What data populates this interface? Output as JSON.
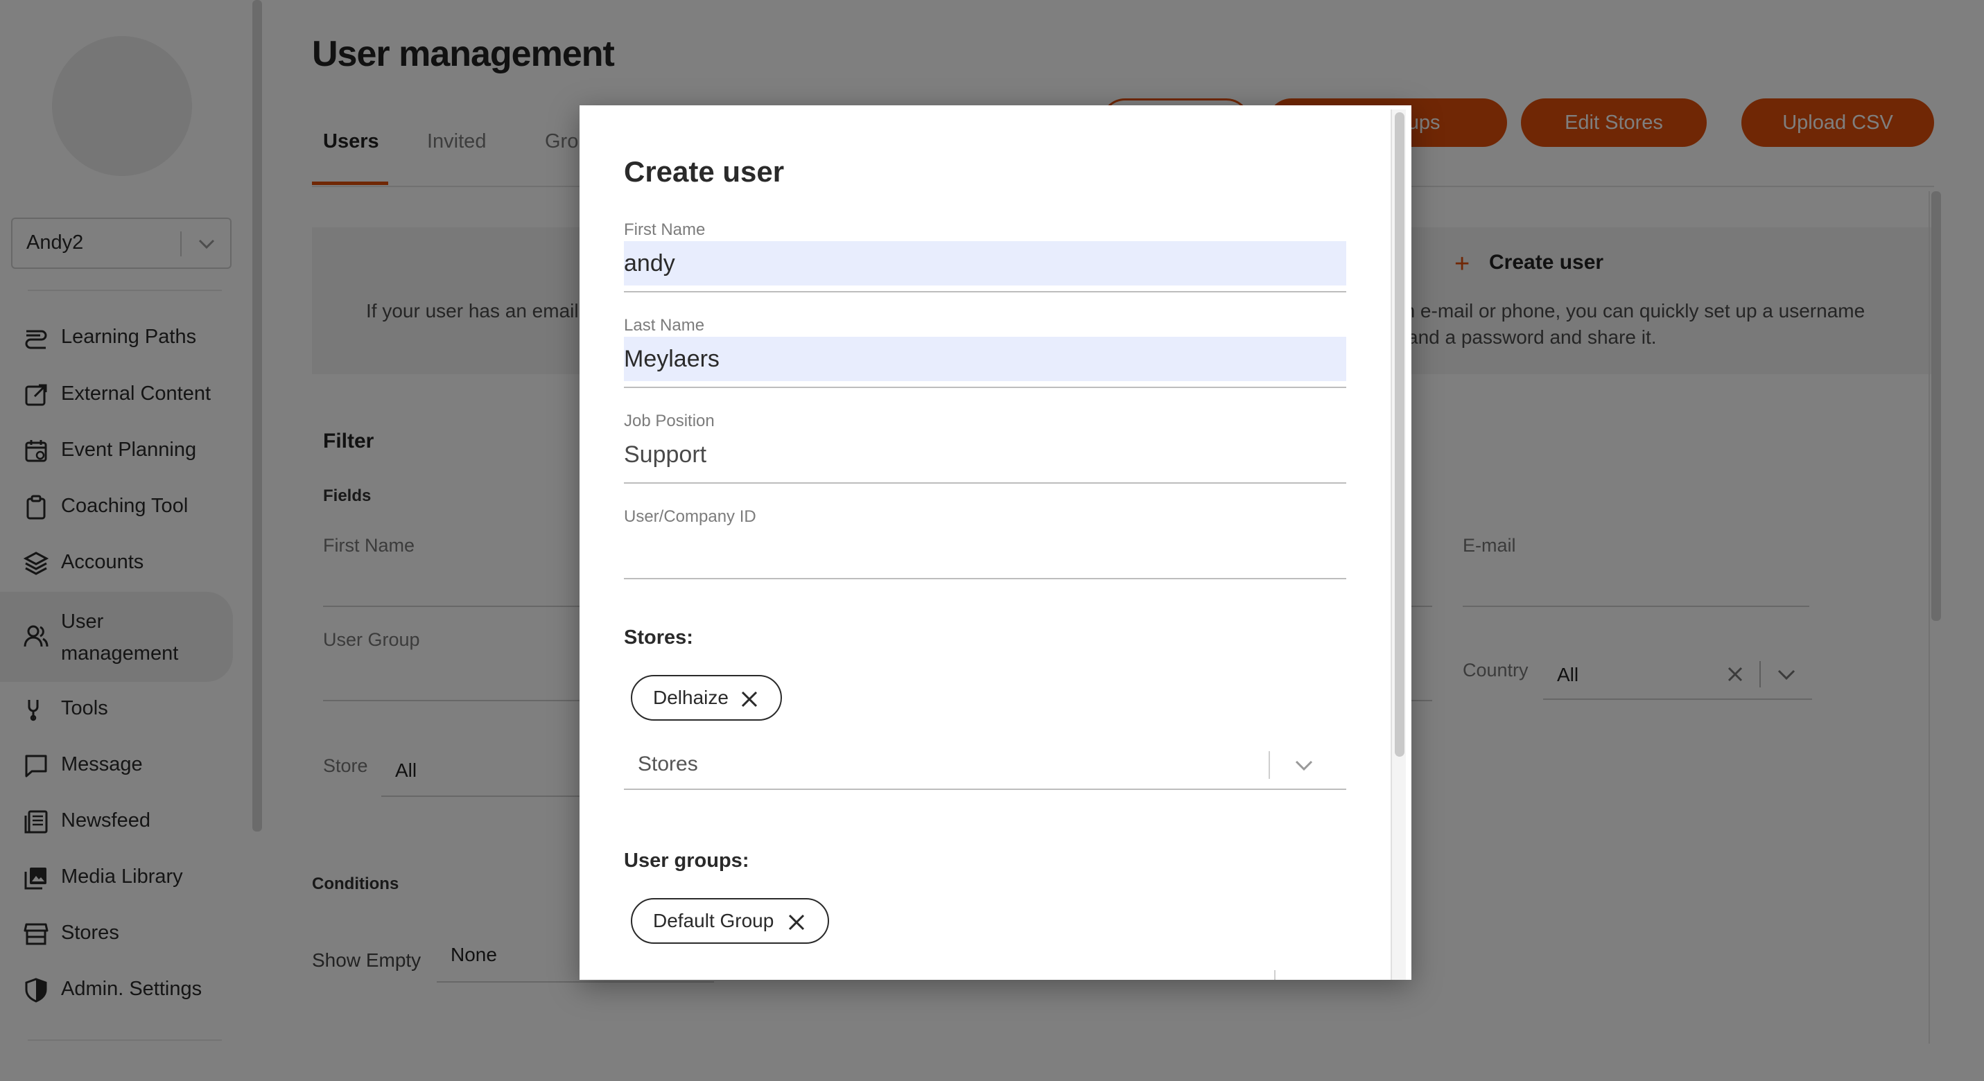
{
  "sidebar": {
    "account": "Andy2",
    "nav": [
      {
        "label": "Learning Paths",
        "icon": "learning-paths-icon"
      },
      {
        "label": "External Content",
        "icon": "external-link-icon"
      },
      {
        "label": "Event Planning",
        "icon": "calendar-icon"
      },
      {
        "label": "Coaching Tool",
        "icon": "clipboard-icon"
      },
      {
        "label": "Accounts",
        "icon": "layers-icon"
      },
      {
        "label": "User management",
        "label_line1": "User",
        "label_line2": "management",
        "icon": "users-icon"
      },
      {
        "label": "Tools",
        "icon": "wrench-icon"
      },
      {
        "label": "Message",
        "icon": "chat-icon"
      },
      {
        "label": "Newsfeed",
        "icon": "newspaper-icon"
      },
      {
        "label": "Media Library",
        "icon": "image-library-icon"
      },
      {
        "label": "Stores",
        "icon": "store-icon"
      },
      {
        "label": "Admin. Settings",
        "icon": "shield-icon"
      }
    ],
    "active_item": "User management"
  },
  "main": {
    "title": "User management",
    "tabs": [
      "Users",
      "Invited",
      "Gro"
    ],
    "active_tab": "Users",
    "buttons": {
      "edit_groups": "Edit Groups",
      "edit_stores": "Edit Stores",
      "upload_csv": "Upload CSV"
    },
    "banner": {
      "left_text": "If your user has an email",
      "create_user": "Create user",
      "right_text_line1": "an e-mail or phone, you can quickly set up a username",
      "right_text_line2": "and a password and share it."
    },
    "filter": {
      "heading": "Filter",
      "fields_heading": "Fields",
      "first_name_label": "First Name",
      "email_label": "E-mail",
      "user_group_label": "User Group",
      "country_label": "Country",
      "country_value": "All",
      "store_label": "Store",
      "store_value": "All",
      "conditions_heading": "Conditions",
      "show_empty_label": "Show Empty",
      "show_empty_value": "None"
    }
  },
  "modal": {
    "title": "Create user",
    "fields": {
      "first_name": {
        "label": "First Name",
        "value": "andy"
      },
      "last_name": {
        "label": "Last Name",
        "value": "Meylaers"
      },
      "job_position": {
        "label": "Job Position",
        "value": "Support"
      },
      "company_id": {
        "label": "User/Company ID",
        "value": ""
      }
    },
    "stores": {
      "heading": "Stores:",
      "chips": [
        "Delhaize"
      ],
      "placeholder": "Stores"
    },
    "user_groups": {
      "heading": "User groups:",
      "chips": [
        "Default Group"
      ]
    }
  },
  "colors": {
    "accent": "#e04e0a",
    "input_fill": "#e8edfd"
  }
}
